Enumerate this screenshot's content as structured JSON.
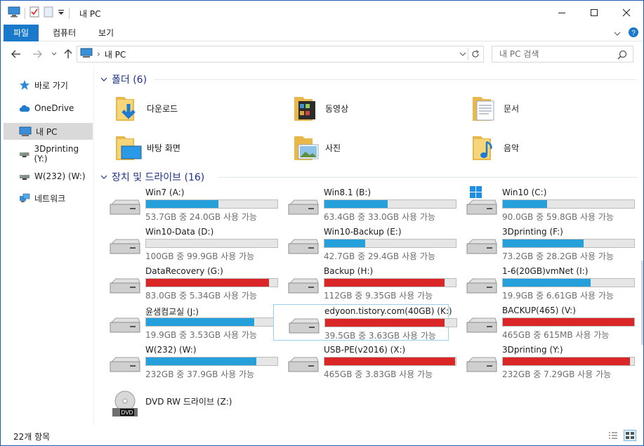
{
  "window": {
    "title": "내 PC",
    "accent": "#1979ca",
    "bar_blue": "#26a0da",
    "bar_red": "#da2626"
  },
  "ribbon": {
    "tabs": [
      {
        "label": "파일",
        "active": true
      },
      {
        "label": "컴퓨터",
        "active": false
      },
      {
        "label": "보기",
        "active": false
      }
    ]
  },
  "address": {
    "path": "내 PC",
    "search_placeholder": "내 PC 검색"
  },
  "sidebar": {
    "items": [
      {
        "label": "바로 가기",
        "icon": "star-icon"
      },
      {
        "label": "OneDrive",
        "icon": "cloud-icon"
      },
      {
        "label": "내 PC",
        "icon": "computer-icon",
        "selected": true
      },
      {
        "label": "3Dprinting (Y:)",
        "icon": "network-drive-icon"
      },
      {
        "label": "W(232) (W:)",
        "icon": "network-drive-icon"
      },
      {
        "label": "네트워크",
        "icon": "network-icon"
      }
    ]
  },
  "folders": {
    "header": "폴더 (6)",
    "items": [
      {
        "label": "다운로드",
        "icon": "downloads-folder-icon"
      },
      {
        "label": "동영상",
        "icon": "videos-folder-icon"
      },
      {
        "label": "문서",
        "icon": "documents-folder-icon"
      },
      {
        "label": "바탕 화면",
        "icon": "desktop-folder-icon"
      },
      {
        "label": "사진",
        "icon": "pictures-folder-icon"
      },
      {
        "label": "음악",
        "icon": "music-folder-icon"
      }
    ]
  },
  "drives": {
    "header": "장치 및 드라이브 (16)",
    "items": [
      {
        "name": "Win7 (A:)",
        "info": "53.7GB 중 24.0GB 사용 가능",
        "used": 0.553,
        "status": "normal"
      },
      {
        "name": "Win8.1 (B:)",
        "info": "63.4GB 중 33.0GB 사용 가능",
        "used": 0.48,
        "status": "normal"
      },
      {
        "name": "Win10 (C:)",
        "info": "90.0GB 중 59.8GB 사용 가능",
        "used": 0.336,
        "status": "normal",
        "windows": true
      },
      {
        "name": "Win10-Data (D:)",
        "info": "100GB 중 99.9GB 사용 가능",
        "used": 0.001,
        "status": "normal"
      },
      {
        "name": "Win10-Backup (E:)",
        "info": "42.7GB 중 29.4GB 사용 가능",
        "used": 0.311,
        "status": "normal"
      },
      {
        "name": "3Dprinting (F:)",
        "info": "73.2GB 중 28.2GB 사용 가능",
        "used": 0.615,
        "status": "normal"
      },
      {
        "name": "DataRecovery (G:)",
        "info": "83.0GB 중 5.34GB 사용 가능",
        "used": 0.936,
        "status": "full"
      },
      {
        "name": "Backup (H:)",
        "info": "112GB 중 9.35GB 사용 가능",
        "used": 0.917,
        "status": "full"
      },
      {
        "name": "1-6(20GB)vmNet (I:)",
        "info": "19.9GB 중 6.61GB 사용 가능",
        "used": 0.668,
        "status": "normal"
      },
      {
        "name": "윤샘컴교실 (J:)",
        "info": "19.9GB 중 3.53GB 사용 가능",
        "used": 0.823,
        "status": "normal"
      },
      {
        "name": "edyoon.tistory.com(40GB) (K:)",
        "info": "39.5GB 중 3.63GB 사용 가능",
        "used": 0.908,
        "status": "full",
        "selected": true
      },
      {
        "name": "BACKUP(465) (V:)",
        "info": "465GB 중 615MB 사용 가능",
        "used": 0.999,
        "status": "full"
      },
      {
        "name": "W(232) (W:)",
        "info": "232GB 중 37.9GB 사용 가능",
        "used": 0.837,
        "status": "normal"
      },
      {
        "name": "USB-PE(v2016) (X:)",
        "info": "465GB 중 3.83GB 사용 가능",
        "used": 0.992,
        "status": "full"
      },
      {
        "name": "3Dprinting (Y:)",
        "info": "232GB 중 7.29GB 사용 가능",
        "used": 0.969,
        "status": "full"
      }
    ],
    "dvd": {
      "name": "DVD RW 드라이브 (Z:)",
      "badge": "DVD"
    }
  },
  "status": {
    "count": "22개 항목"
  }
}
